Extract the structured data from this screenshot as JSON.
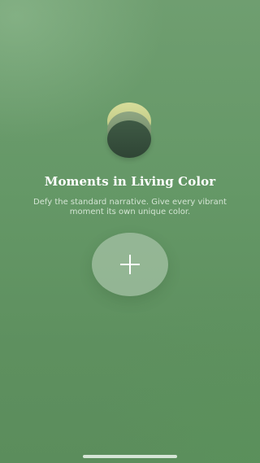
{
  "onboarding": {
    "title": "Moments in Living Color",
    "subtitle": "Defy the standard narrative. Give every vibrant moment its own unique color.",
    "add_button_icon": "plus-icon"
  },
  "logo": {
    "icon": "stacked-discs-logo",
    "colors": [
      "#cfd592",
      "#7e9874",
      "#35503c"
    ]
  },
  "theme": {
    "background": "#649466",
    "text": "#ffffff"
  }
}
